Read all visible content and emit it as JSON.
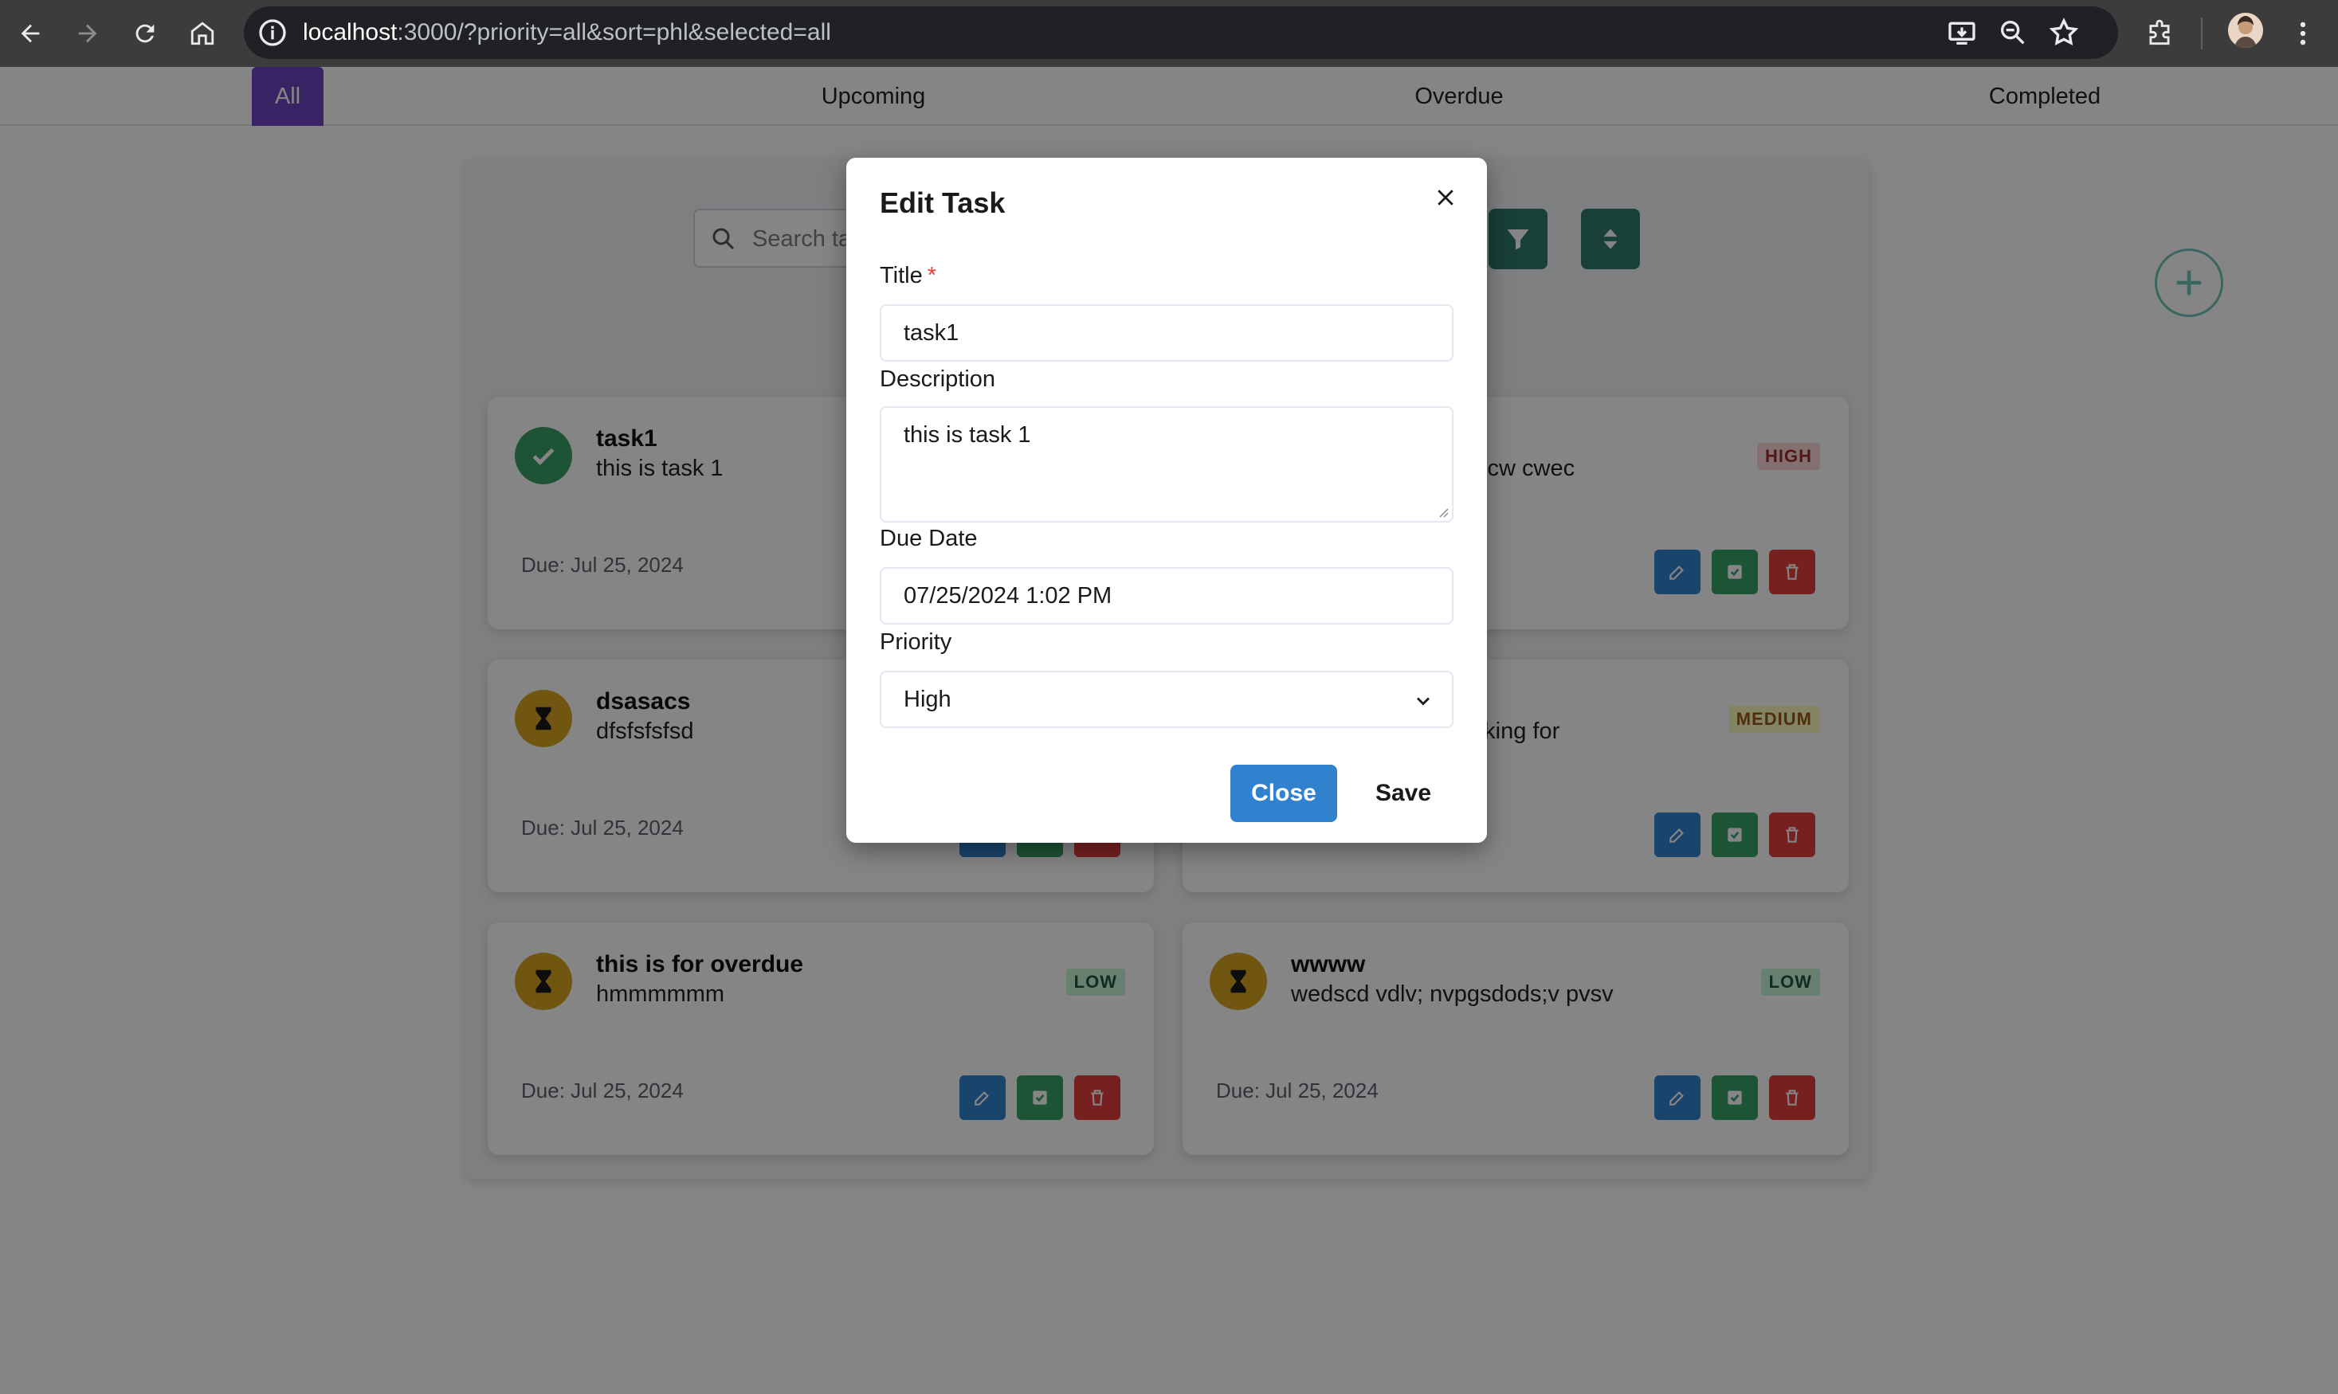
{
  "browser": {
    "url_host": "localhost",
    "url_rest": ":3000/?priority=all&sort=phl&selected=all"
  },
  "tabs": [
    {
      "label": "All"
    },
    {
      "label": "Upcoming"
    },
    {
      "label": "Overdue"
    },
    {
      "label": "Completed"
    }
  ],
  "toolbar": {
    "search_placeholder": "Search tasks"
  },
  "tasks": [
    {
      "title": "task1",
      "description": "this is task 1",
      "due": "Due: Jul 25, 2024",
      "status": "completed"
    },
    {
      "title": "",
      "description": "scw cwec",
      "due": "",
      "priority": "HIGH"
    },
    {
      "title": "dsasacs",
      "description": "dfsfsfsfsd",
      "due": "Due: Jul 25, 2024",
      "status": "pending"
    },
    {
      "title": "",
      "description": "oking for",
      "due": "",
      "priority": "MEDIUM"
    },
    {
      "title": "this is for overdue",
      "description": "hmmmmmm",
      "due": "Due: Jul 25, 2024",
      "priority": "LOW",
      "status": "pending"
    },
    {
      "title": "wwww",
      "description": "wedscd vdlv; nvpgsdods;v pvsv",
      "due": "Due: Jul 25, 2024",
      "priority": "LOW",
      "status": "pending"
    }
  ],
  "modal": {
    "title": "Edit Task",
    "title_label": "Title",
    "required_mark": "*",
    "title_value": "task1",
    "description_label": "Description",
    "description_value": "this is task 1",
    "due_label": "Due Date",
    "due_value": "07/25/2024 1:02 PM",
    "priority_label": "Priority",
    "priority_value": "High",
    "close_label": "Close",
    "save_label": "Save"
  },
  "colors": {
    "accent": "#6b46c1",
    "teal": "#2f7a6b",
    "edit": "#3182ce",
    "complete": "#38a169",
    "delete": "#e53e3e"
  }
}
